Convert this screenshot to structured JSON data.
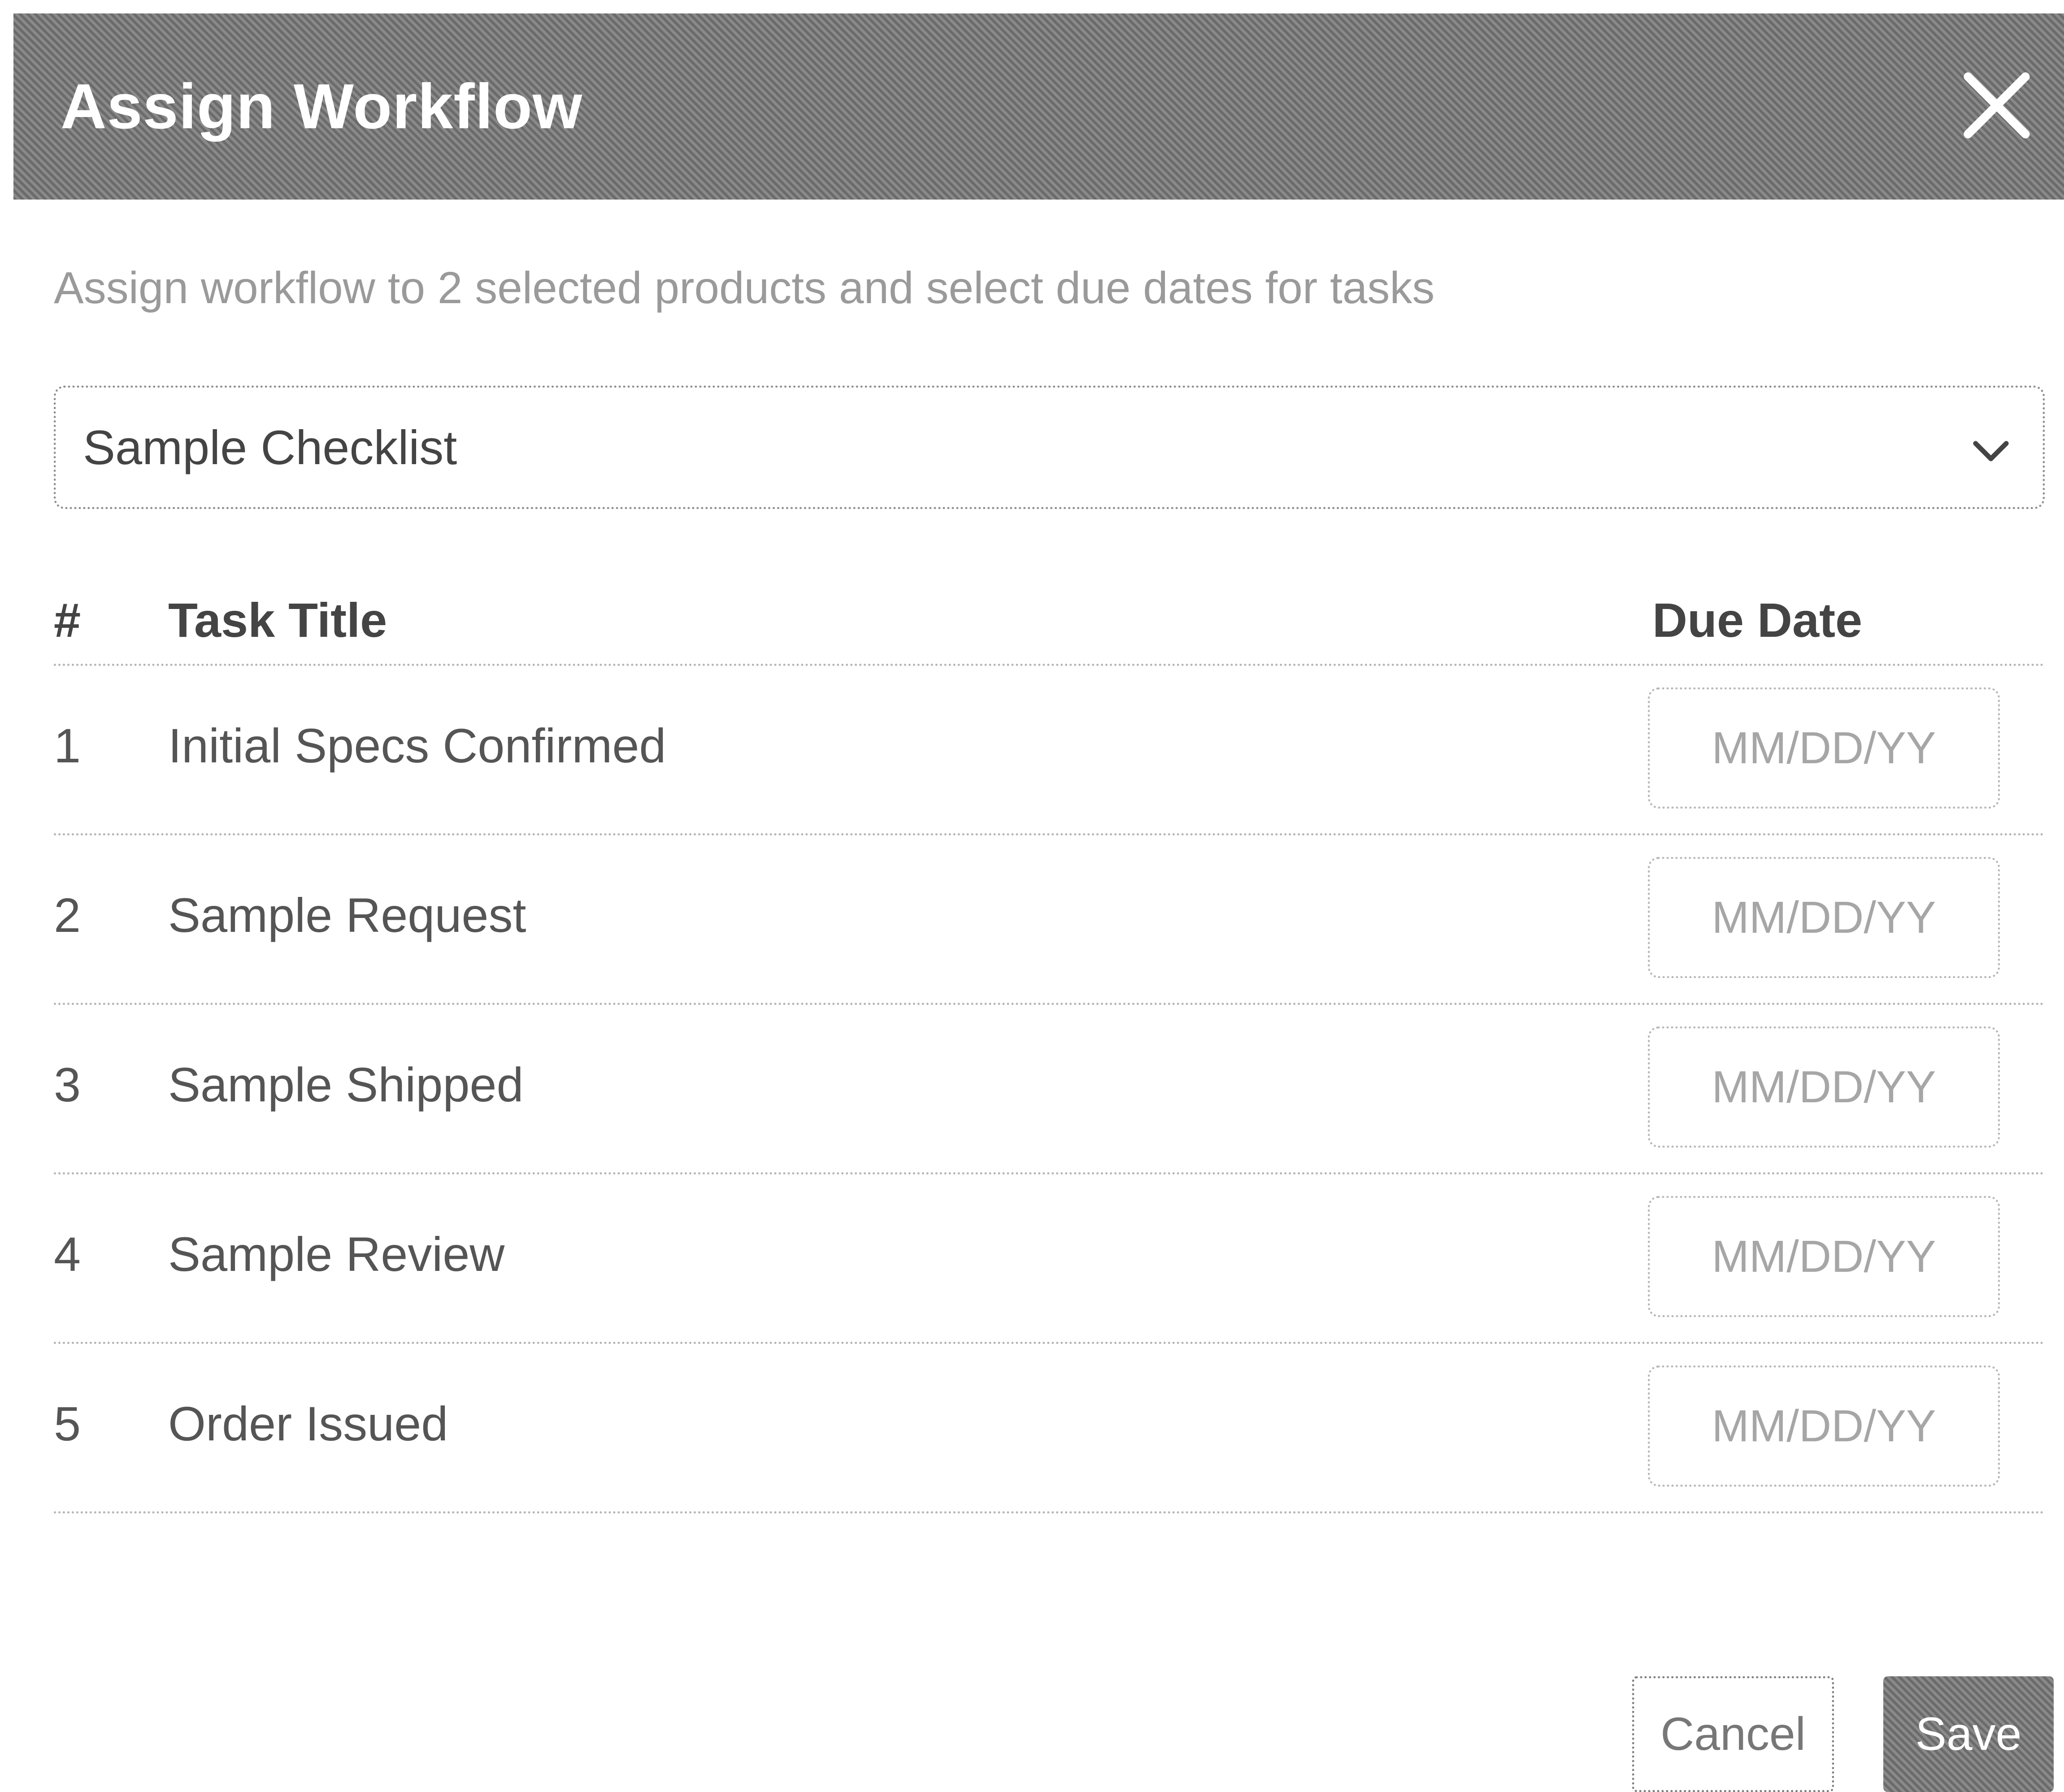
{
  "dialog": {
    "title": "Assign Workflow",
    "close_icon": "close-icon",
    "subtitle": "Assign workflow to 2 selected products and select due dates for tasks"
  },
  "workflow_select": {
    "value": "Sample Checklist",
    "icon": "chevron-down-icon"
  },
  "table": {
    "headers": {
      "number": "#",
      "title": "Task Title",
      "due_date": "Due Date"
    },
    "rows": [
      {
        "number": "1",
        "title": "Initial Specs Confirmed",
        "due_placeholder": "MM/DD/YY"
      },
      {
        "number": "2",
        "title": "Sample Request",
        "due_placeholder": "MM/DD/YY"
      },
      {
        "number": "3",
        "title": "Sample Shipped",
        "due_placeholder": "MM/DD/YY"
      },
      {
        "number": "4",
        "title": "Sample Review",
        "due_placeholder": "MM/DD/YY"
      },
      {
        "number": "5",
        "title": "Order Issued",
        "due_placeholder": "MM/DD/YY"
      }
    ]
  },
  "footer": {
    "cancel_label": "Cancel",
    "save_label": "Save"
  },
  "colors": {
    "header_bg": "#777777",
    "save_bg": "#777777",
    "text_primary": "#444444",
    "text_muted": "#9a9a9a"
  }
}
